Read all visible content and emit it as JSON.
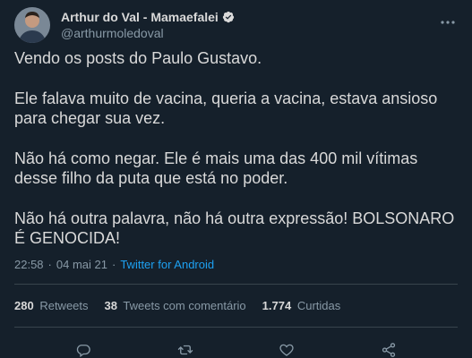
{
  "author": {
    "display_name": "Arthur do Val - Mamaefalei",
    "handle": "@arthurmoledoval"
  },
  "tweet": {
    "paragraphs": [
      "Vendo os posts do Paulo Gustavo.",
      "Ele falava muito de vacina, queria a vacina, estava ansioso para chegar sua vez.",
      "Não há como negar. Ele é mais uma das 400 mil vítimas desse filho da puta que está no poder.",
      "Não há outra palavra, não há outra expressão! BOLSONARO É GENOCIDA!"
    ],
    "time": "22:58",
    "date": "04 mai 21",
    "source": "Twitter for Android"
  },
  "stats": {
    "retweets_count": "280",
    "retweets_label": "Retweets",
    "quotes_count": "38",
    "quotes_label": "Tweets com comentário",
    "likes_count": "1.774",
    "likes_label": "Curtidas"
  },
  "icons": {
    "verified": "verified-badge-icon",
    "more": "more-options-icon",
    "reply": "reply-icon",
    "retweet": "retweet-icon",
    "like": "heart-icon",
    "share": "share-icon"
  },
  "colors": {
    "background": "#15202b",
    "accent": "#1da1f2",
    "muted": "#8899a6",
    "text": "#d9d9d9",
    "divider": "#38444d"
  }
}
